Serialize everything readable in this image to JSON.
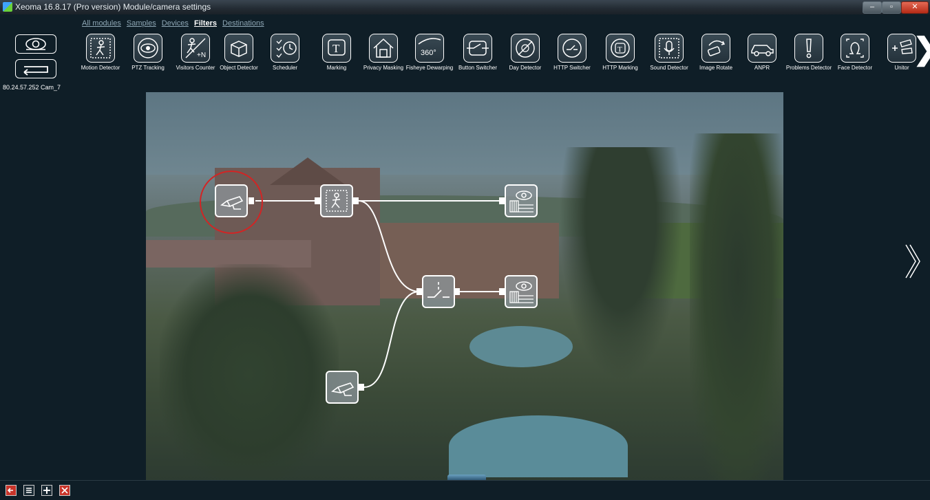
{
  "window": {
    "title": "Xeoma 16.8.17 (Pro version) Module/camera settings",
    "minimize_label": "–",
    "maximize_label": "▫",
    "close_label": "✕"
  },
  "tabs": [
    {
      "label": "All modules",
      "active": false
    },
    {
      "label": "Samples",
      "active": false
    },
    {
      "label": "Devices",
      "active": false
    },
    {
      "label": "Filters",
      "active": true
    },
    {
      "label": "Destinations",
      "active": false
    }
  ],
  "camera_label": "80.24.57.252 Cam_7",
  "toolbar_items": [
    {
      "label": "Motion Detector",
      "icon": "motion-detector-icon"
    },
    {
      "label": "PTZ Tracking",
      "icon": "ptz-tracking-icon"
    },
    {
      "label": "Visitors Counter",
      "icon": "visitors-counter-icon"
    },
    {
      "label": "Object Detector",
      "icon": "object-detector-icon"
    },
    {
      "label": "Scheduler",
      "icon": "scheduler-icon"
    },
    {
      "label": "Marking",
      "icon": "marking-icon"
    },
    {
      "label": "Privacy Masking",
      "icon": "privacy-masking-icon"
    },
    {
      "label": "Fisheye Dewarping",
      "icon": "fisheye-dewarping-icon"
    },
    {
      "label": "Button Switcher",
      "icon": "button-switcher-icon"
    },
    {
      "label": "Day Detector",
      "icon": "day-detector-icon"
    },
    {
      "label": "HTTP Switcher",
      "icon": "http-switcher-icon"
    },
    {
      "label": "HTTP Marking",
      "icon": "http-marking-icon"
    },
    {
      "label": "Sound Detector",
      "icon": "sound-detector-icon"
    },
    {
      "label": "Image Rotate",
      "icon": "image-rotate-icon"
    },
    {
      "label": "ANPR",
      "icon": "anpr-icon"
    },
    {
      "label": "Problems Detector",
      "icon": "problems-detector-icon"
    },
    {
      "label": "Face Detector",
      "icon": "face-detector-icon"
    },
    {
      "label": "Unitor",
      "icon": "unitor-icon"
    }
  ],
  "icon_text": {
    "marking": "T",
    "fisheye": "360°",
    "visitors": "+N"
  },
  "scroll_right_label": "❯",
  "nodes": [
    {
      "name": "camera-node-1",
      "icon": "camera-icon",
      "selected": true
    },
    {
      "name": "motion-detector-node",
      "icon": "motion-detector-icon"
    },
    {
      "name": "preview-archive-node-1",
      "icon": "preview-archive-icon"
    },
    {
      "name": "switcher-node",
      "icon": "switcher-icon"
    },
    {
      "name": "preview-archive-node-2",
      "icon": "preview-archive-icon"
    },
    {
      "name": "camera-node-2",
      "icon": "camera-icon"
    }
  ],
  "colors": {
    "accent": "#ffffff",
    "selection_ring": "#d32424",
    "background": "#0f1e27"
  }
}
